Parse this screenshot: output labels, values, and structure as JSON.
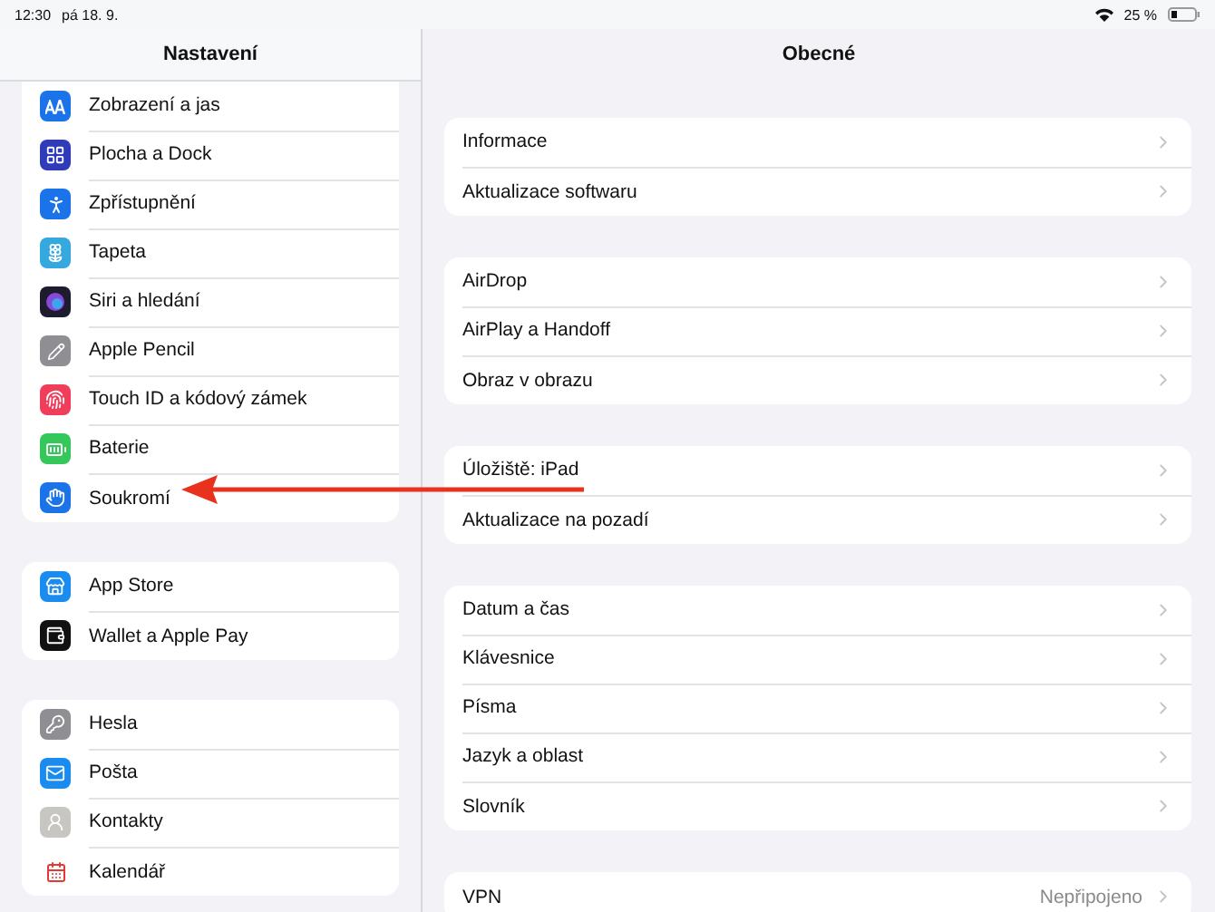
{
  "status_bar": {
    "time": "12:30",
    "date": "pá 18. 9.",
    "battery": "25 %"
  },
  "sidebar": {
    "title": "Nastavení",
    "groups": [
      {
        "items": [
          {
            "label": "Zobrazení a jas"
          },
          {
            "label": "Plocha a Dock"
          },
          {
            "label": "Zpřístupnění"
          },
          {
            "label": "Tapeta"
          },
          {
            "label": "Siri a hledání"
          },
          {
            "label": "Apple Pencil"
          },
          {
            "label": "Touch ID a kódový zámek"
          },
          {
            "label": "Baterie"
          },
          {
            "label": "Soukromí"
          }
        ]
      },
      {
        "items": [
          {
            "label": "App Store"
          },
          {
            "label": "Wallet a Apple Pay"
          }
        ]
      },
      {
        "items": [
          {
            "label": "Hesla"
          },
          {
            "label": "Pošta"
          },
          {
            "label": "Kontakty"
          },
          {
            "label": "Kalendář"
          }
        ]
      }
    ]
  },
  "detail": {
    "title": "Obecné",
    "groups": [
      {
        "items": [
          {
            "label": "Informace"
          },
          {
            "label": "Aktualizace softwaru"
          }
        ]
      },
      {
        "items": [
          {
            "label": "AirDrop"
          },
          {
            "label": "AirPlay a Handoff"
          },
          {
            "label": "Obraz v obrazu"
          }
        ]
      },
      {
        "items": [
          {
            "label": "Úložiště: iPad"
          },
          {
            "label": "Aktualizace na pozadí"
          }
        ]
      },
      {
        "items": [
          {
            "label": "Datum a čas"
          },
          {
            "label": "Klávesnice"
          },
          {
            "label": "Písma"
          },
          {
            "label": "Jazyk a oblast"
          },
          {
            "label": "Slovník"
          }
        ]
      },
      {
        "items": [
          {
            "label": "VPN",
            "value": "Nepřipojeno"
          }
        ]
      }
    ]
  }
}
